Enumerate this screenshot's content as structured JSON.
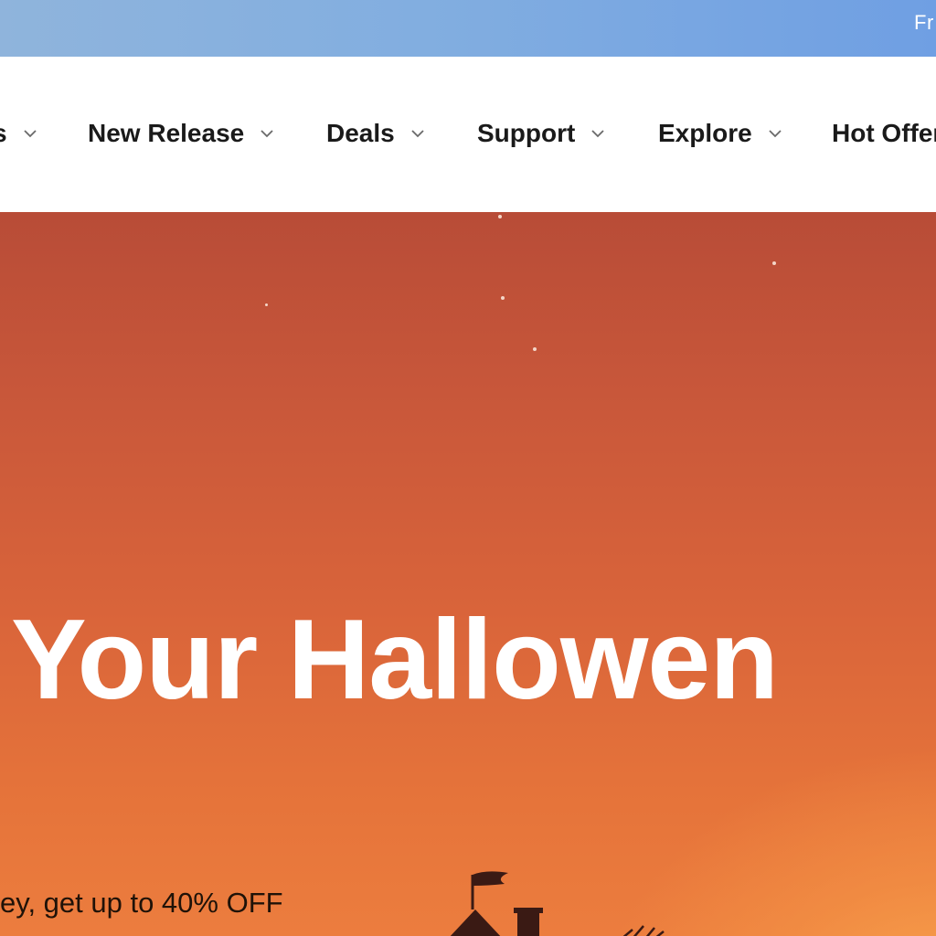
{
  "topbar": {
    "text": "Fr",
    "bg_colors": [
      "#8fb4dc",
      "#6f9fe3"
    ]
  },
  "nav": {
    "items": [
      {
        "label": "s"
      },
      {
        "label": "New Release"
      },
      {
        "label": "Deals"
      },
      {
        "label": "Support"
      },
      {
        "label": "Explore"
      },
      {
        "label": "Hot Offer"
      }
    ],
    "chevron_icon": "chevron-down-icon"
  },
  "hero": {
    "title": "Your Hallowen",
    "subtitle": "ey, get up to 40% OFF",
    "colors": {
      "sky_top": "#b84c37",
      "sky_bottom": "#ec7d3e",
      "glow": "#f7a24f"
    }
  }
}
